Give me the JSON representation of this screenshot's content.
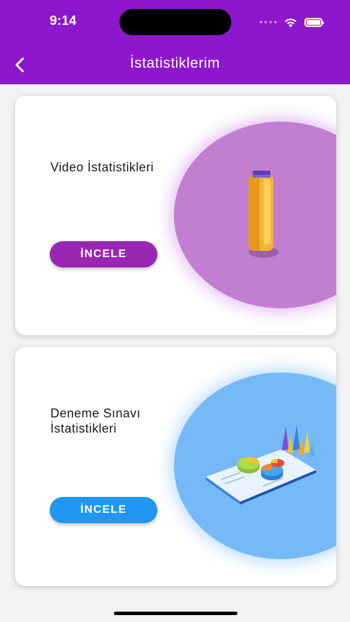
{
  "status_bar": {
    "time": "9:14"
  },
  "header": {
    "title": "İstatistiklerim",
    "back_icon": "chevron-left-icon",
    "background": "#8d17cc"
  },
  "cards": [
    {
      "title": "Video İstatistikleri",
      "button_label": "İNCELE",
      "accent": "#9a27b4",
      "circle_color": "#c27fd1",
      "illustration": "bracelet-icon"
    },
    {
      "title": "Deneme Sınavı İstatistikleri",
      "button_label": "İNCELE",
      "accent": "#2196f3",
      "circle_color": "#76b9f7",
      "illustration": "statistics-chart-icon"
    }
  ]
}
